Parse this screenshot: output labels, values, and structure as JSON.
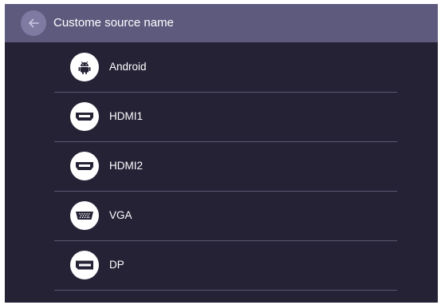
{
  "header": {
    "title": "Custome source name",
    "back_icon": "arrow-left-icon"
  },
  "sources": [
    {
      "label": "Android",
      "icon": "android-icon"
    },
    {
      "label": "HDMI1",
      "icon": "hdmi-icon"
    },
    {
      "label": "HDMI2",
      "icon": "hdmi-icon"
    },
    {
      "label": "VGA",
      "icon": "vga-icon"
    },
    {
      "label": "DP",
      "icon": "displayport-icon"
    }
  ],
  "colors": {
    "background": "#262236",
    "header": "#5d5a7e",
    "back_button": "#7e7aa1",
    "divider": "#5a566f",
    "icon_bg": "#ffffff",
    "icon_fg": "#262236",
    "text": "#ffffff"
  }
}
